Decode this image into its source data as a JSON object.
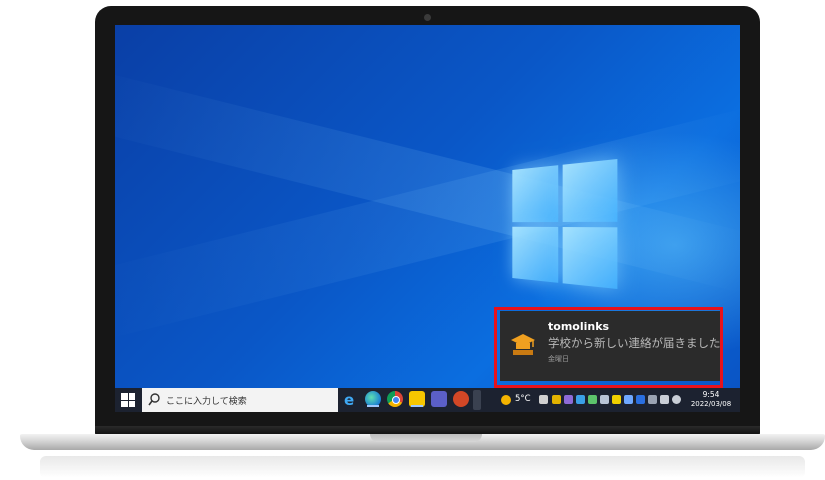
{
  "notification": {
    "app_name": "tomolinks",
    "message": "学校から新しい連絡が届きました",
    "time": "金曜日",
    "icon": "graduation-cap-icon"
  },
  "taskbar": {
    "search_placeholder": "ここに入力して検索",
    "pinned_apps": [
      "internet-explorer-icon",
      "edge-icon",
      "chrome-icon",
      "sticky-notes-icon",
      "teams-icon",
      "powerpoint-icon"
    ],
    "weather": "5°C",
    "clock_time": "9:54",
    "clock_date": "2022/03/08"
  },
  "colors": {
    "highlight_border": "#e8121b",
    "desktop_blue": "#0a57c7",
    "taskbar": "#1c2230",
    "toast_background": "#2b2b2b"
  }
}
